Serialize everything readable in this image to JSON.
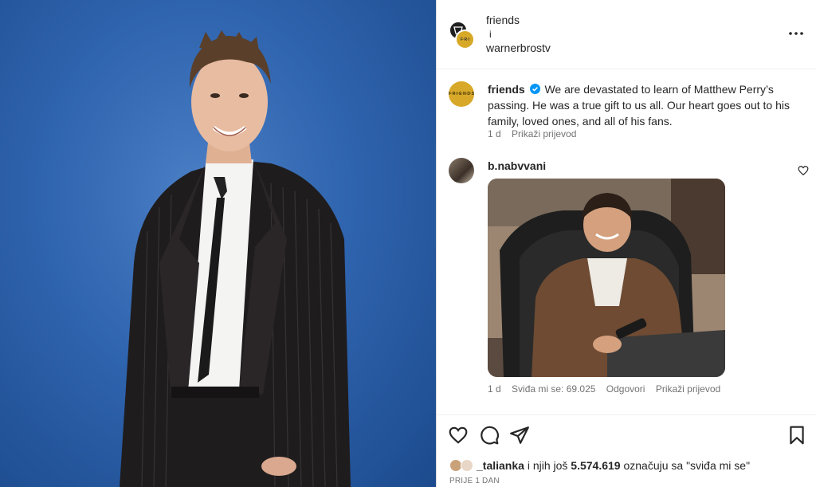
{
  "post": {
    "image_alt": "Matthew Perry portrait on blue background"
  },
  "header": {
    "user1": "friends",
    "separator": "i",
    "user2": "warnerbrostv",
    "more_icon": "more-horizontal-icon"
  },
  "caption": {
    "username": "friends",
    "text": "We are devastated to learn of Matthew Perry’s passing. He was a true gift to us all. Our heart goes out to his family, loved ones, and all of his fans.",
    "time": "1 d",
    "translate": "Prikaži prijevod",
    "verified_icon": "verified-badge-icon"
  },
  "comment": {
    "username": "b.nabvvani",
    "time": "1 d",
    "likes": "Sviđa mi se: 69.025",
    "reply": "Odgovori",
    "translate": "Prikaži prijevod",
    "like_icon": "heart-outline-icon"
  },
  "actions": {
    "like_icon": "heart-icon",
    "comment_icon": "comment-icon",
    "share_icon": "send-icon",
    "save_icon": "bookmark-icon"
  },
  "likes_summary": {
    "user": "_talianka",
    "middle": " i njih još ",
    "count": "5.574.619",
    "suffix": " označuju sa \"sviđa mi se\""
  },
  "timestamp": "PRIJE 1 DAN",
  "colors": {
    "background_blue": "#2f64ae",
    "friends_gold": "#d8a928",
    "verified_blue": "#0095f6",
    "meta_gray": "#737373"
  }
}
